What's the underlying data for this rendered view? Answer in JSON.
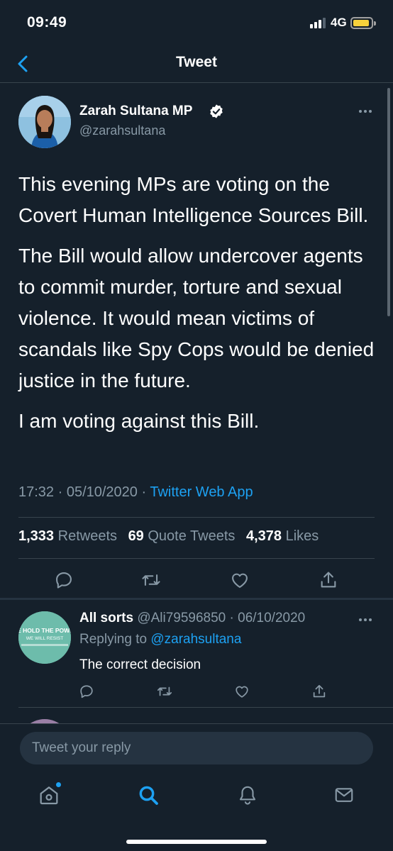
{
  "status_bar": {
    "time": "09:49",
    "network": "4G"
  },
  "header": {
    "title": "Tweet"
  },
  "tweet": {
    "author_name": "Zarah Sultana MP",
    "author_handle": "@zarahsultana",
    "paragraphs": [
      "This evening MPs are voting on the Covert Human Intelligence Sources Bill.",
      "The Bill would allow undercover agents to commit murder, torture and sexual violence. It would mean victims of scandals like Spy Cops would be denied justice in the future.",
      "I am voting against this Bill."
    ],
    "timestamp": "17:32 · 05/10/2020 ·",
    "source": "Twitter Web App",
    "stats": {
      "retweets_count": "1,333",
      "retweets_label": "Retweets",
      "quotes_count": "69",
      "quotes_label": "Quote Tweets",
      "likes_count": "4,378",
      "likes_label": "Likes"
    }
  },
  "reply": {
    "author_name": "All sorts",
    "author_handle_date": "@Ali79596850 · 06/10/2020",
    "replying_prefix": "Replying to",
    "replying_to": "@zarahsultana",
    "text": "The correct decision",
    "avatar_text_line1": "WE HOLD THE POWER",
    "avatar_text_line2": "WE WILL RESIST"
  },
  "composer": {
    "placeholder": "Tweet your reply"
  },
  "colors": {
    "background": "#15202b",
    "accent": "#1da1f2",
    "muted": "#8899a6",
    "divider": "#38444d"
  },
  "icons": {
    "back": "chevron-left-icon",
    "verified": "verified-badge-icon",
    "more": "more-horizontal-icon",
    "reply": "reply-icon",
    "retweet": "retweet-icon",
    "like": "heart-icon",
    "share": "share-icon",
    "home": "home-icon",
    "search": "search-icon",
    "notifications": "bell-icon",
    "messages": "mail-icon"
  }
}
